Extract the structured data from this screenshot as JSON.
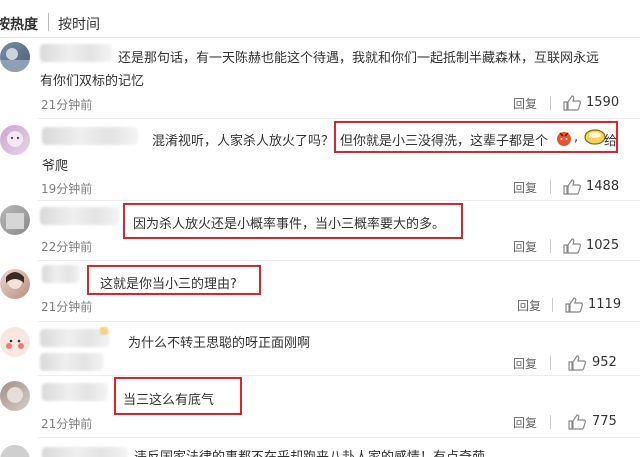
{
  "sort": {
    "hot": "按热度",
    "time": "按时间"
  },
  "reply_label": "回复",
  "comments": [
    {
      "text_line1": "还是那句话，有一天陈赫也能这个待遇，我就和你们一起抵制半藏森林，互联网永远",
      "text_line2": "有你们双标的记忆",
      "time": "21分钟前",
      "likes": "1590"
    },
    {
      "text_pre": "混淆视听，人家杀人放火了吗？",
      "text_boxed": "但你就是小三没得洗，这辈子都是个",
      "text_post": "给",
      "text_line2": "爷爬",
      "time": "19分钟前",
      "likes": "1488"
    },
    {
      "text": "因为杀人放火还是小概率事件，当小三概率要大的多。",
      "time": "22分钟前",
      "likes": "1025"
    },
    {
      "text": "这就是你当小三的理由?",
      "time": "21分钟前",
      "likes": "1119"
    },
    {
      "text": "为什么不转王思聪的呀正面刚啊",
      "time": "",
      "likes": "952"
    },
    {
      "text": "当三这么有底气",
      "time": "21分钟前",
      "likes": "775"
    },
    {
      "text": "违反国家法律的事都不在乎却跑来八卦人家的感情！有点奇葩"
    }
  ],
  "colors": {
    "highlight_box": "#d9262c",
    "time_text": "#808080"
  }
}
